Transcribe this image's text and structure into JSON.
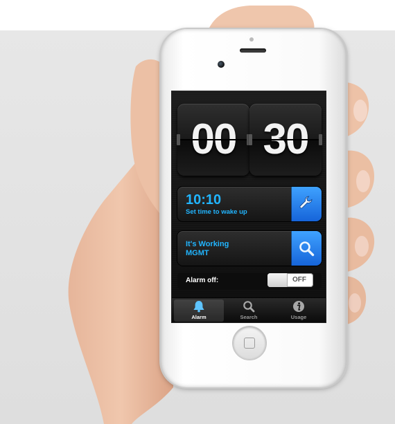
{
  "clock": {
    "hours": "00",
    "minutes": "30"
  },
  "alarm_panel": {
    "time": "10:10",
    "subtitle": "Set time to wake up",
    "action_icon": "wrench-icon"
  },
  "station_panel": {
    "line1": "It's Working",
    "line2": "MGMT",
    "action_icon": "search-icon"
  },
  "alarm_toggle": {
    "label": "Alarm off:",
    "state": "OFF"
  },
  "tabs": [
    {
      "label": "Alarm",
      "icon": "bell-icon",
      "selected": true
    },
    {
      "label": "Search",
      "icon": "search-icon",
      "selected": false
    },
    {
      "label": "Usage",
      "icon": "info-icon",
      "selected": false
    }
  ],
  "colors": {
    "accent": "#21b5ff",
    "button_blue": "#1e78e8"
  }
}
